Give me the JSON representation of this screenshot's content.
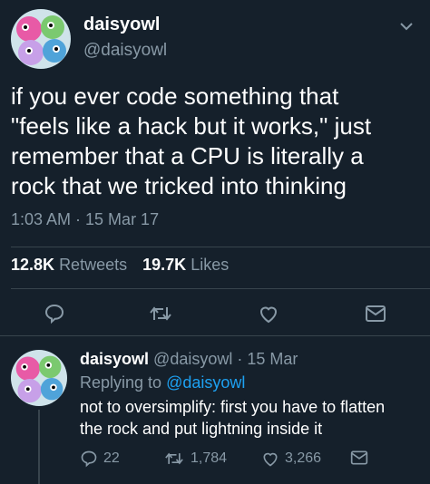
{
  "tweet": {
    "display_name": "daisyowl",
    "handle": "@daisyowl",
    "text": "if you ever code something that\n\"feels like a hack but it works,\" just\nremember that a CPU is literally a\nrock that we tricked into thinking",
    "timestamp": "1:03 AM · 15 Mar 17",
    "retweets_count": "12.8K",
    "retweets_label": "Retweets",
    "likes_count": "19.7K",
    "likes_label": "Likes",
    "actions": [
      "reply-icon",
      "retweet-icon",
      "like-icon",
      "dm-icon"
    ]
  },
  "reply": {
    "display_name": "daisyowl",
    "handle_date": "@daisyowl · 15 Mar",
    "replying_label": "Replying to",
    "replying_handle": "@daisyowl",
    "text": "not to oversimplify: first you have to flatten\nthe rock and put lightning inside it",
    "reply_count": "22",
    "retweet_count": "1,784",
    "like_count": "3,266"
  },
  "colors": {
    "background": "#15202b",
    "muted": "#8899a6",
    "link": "#1da1f2",
    "divider": "#38444d"
  }
}
